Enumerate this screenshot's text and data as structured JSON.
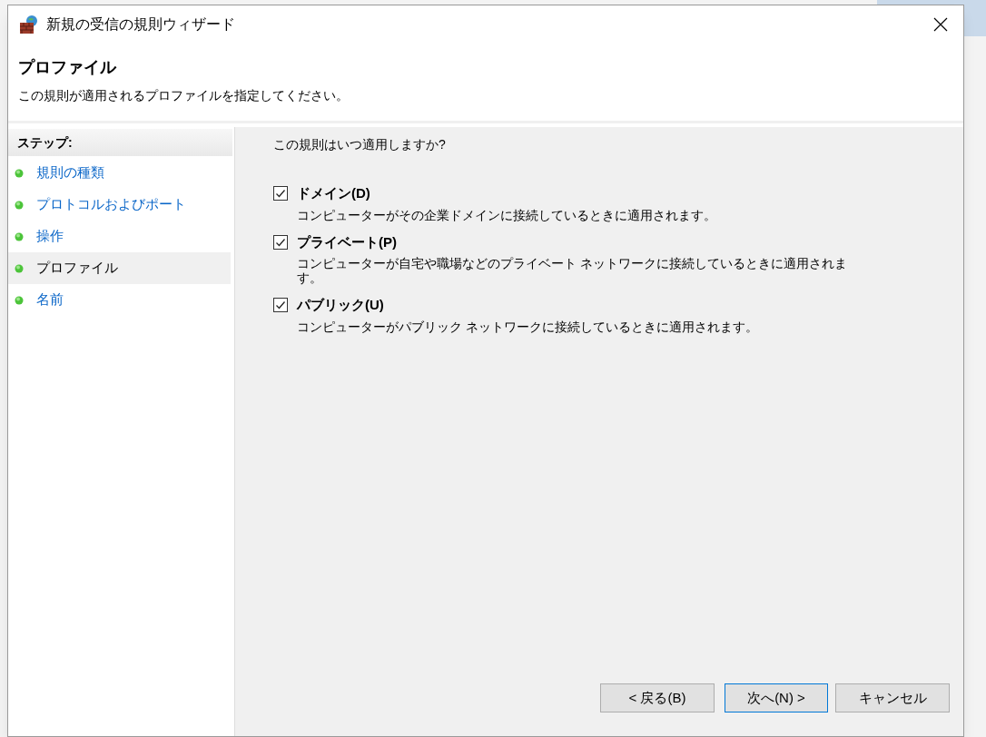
{
  "window": {
    "title": "新規の受信の規則ウィザード"
  },
  "header": {
    "title": "プロファイル",
    "subtitle": "この規則が適用されるプロファイルを指定してください。"
  },
  "steps": {
    "heading": "ステップ:",
    "items": [
      {
        "label": "規則の種類",
        "selected": false
      },
      {
        "label": "プロトコルおよびポート",
        "selected": false
      },
      {
        "label": "操作",
        "selected": false
      },
      {
        "label": "プロファイル",
        "selected": true
      },
      {
        "label": "名前",
        "selected": false
      }
    ]
  },
  "content": {
    "question": "この規則はいつ適用しますか?",
    "options": [
      {
        "label": "ドメイン(D)",
        "checked": true,
        "description": "コンピューターがその企業ドメインに接続しているときに適用されます。"
      },
      {
        "label": "プライベート(P)",
        "checked": true,
        "description": "コンピューターが自宅や職場などのプライベート ネットワークに接続しているときに適用されます。"
      },
      {
        "label": "パブリック(U)",
        "checked": true,
        "description": "コンピューターがパブリック ネットワークに接続しているときに適用されます。"
      }
    ]
  },
  "buttons": [
    {
      "label": "< 戻る(B)",
      "default": false
    },
    {
      "label": "次へ(N) >",
      "default": true
    },
    {
      "label": "キャンセル",
      "default": false
    }
  ]
}
